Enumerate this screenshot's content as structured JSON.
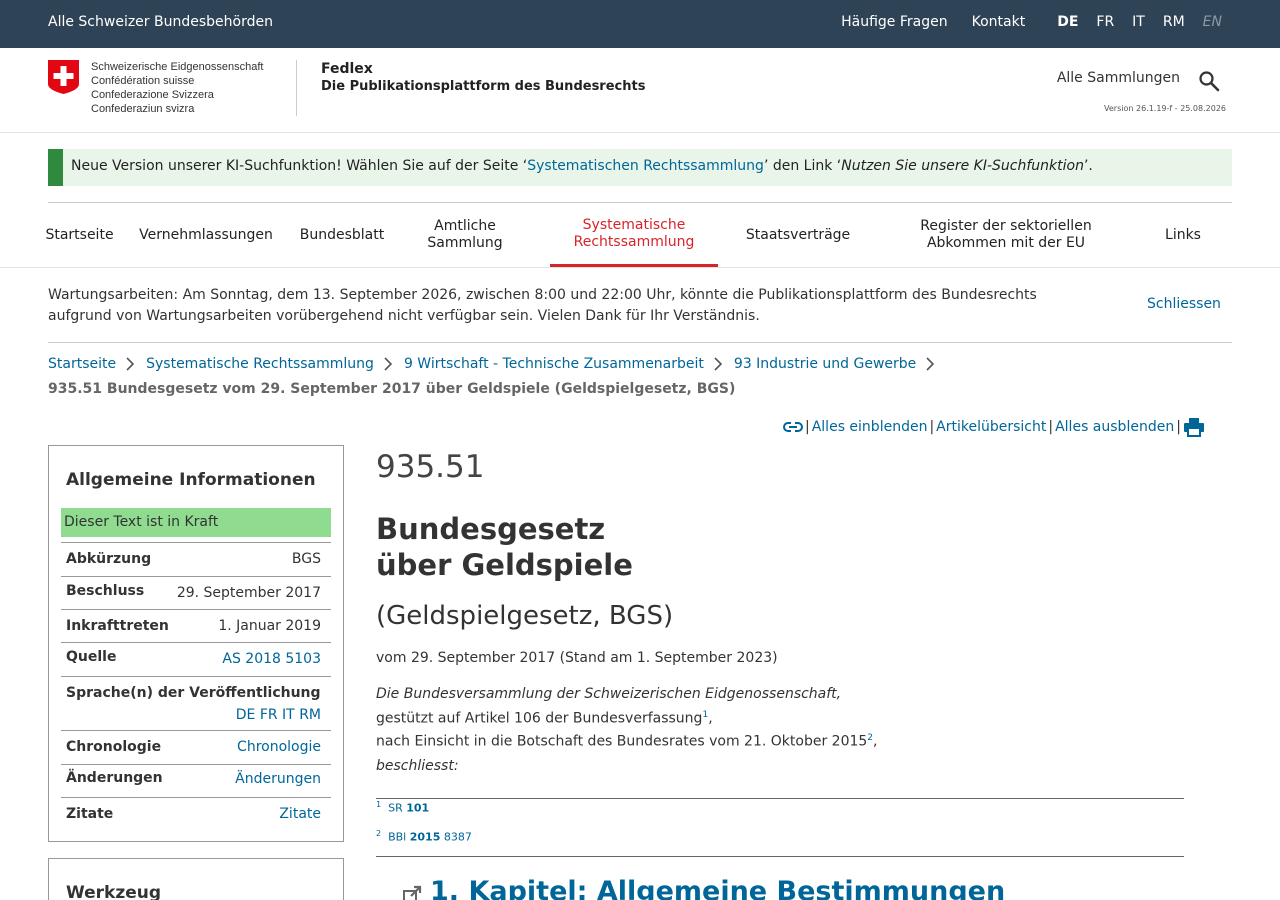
{
  "topbar": {
    "left": "Alle Schweizer Bundesbehörden",
    "faq": "Häufige Fragen",
    "contact": "Kontakt",
    "langs": [
      "DE",
      "FR",
      "IT",
      "RM",
      "EN"
    ]
  },
  "header": {
    "conf": [
      "Schweizerische Eidgenossenschaft",
      "Confédération suisse",
      "Confederazione Svizzera",
      "Confederaziun svizra"
    ],
    "title": "Fedlex",
    "subtitle": "Die Publikationsplattform des Bundesrechts",
    "collections": "Alle Sammlungen",
    "version": "Version 26.1.19-f - 25.08.2026"
  },
  "banner": {
    "pre": "Neue Version unserer KI-Suchfunktion! Wählen Sie auf der Seite ‘",
    "link": "Systematischen Rechtssammlung",
    "mid": "’ den Link ‘",
    "italic": "Nutzen Sie unsere KI-Suchfunktion",
    "post": "’."
  },
  "nav": [
    {
      "label": "Startseite"
    },
    {
      "label": "Vernehmlassungen"
    },
    {
      "label": "Bundesblatt"
    },
    {
      "label": "Amtliche Sammlung"
    },
    {
      "label": "Systematische Rechtssammlung"
    },
    {
      "label": "Staatsverträge"
    },
    {
      "label": "Register der sektoriellen Abkommen mit der EU"
    },
    {
      "label": "Links"
    }
  ],
  "maintenance": {
    "text": "Wartungsarbeiten: Am Sonntag, dem 13. September 2026, zwischen 8:00 und 22:00 Uhr, könnte die Publikationsplattform des Bundesrechts aufgrund von Wartungsarbeiten vorübergehend nicht verfügbar sein. Vielen Dank für Ihr Verständnis.",
    "close": "Schliessen"
  },
  "breadcrumb": {
    "items": [
      "Startseite",
      "Systematische Rechtssammlung",
      "9 Wirtschaft - Technische Zusammenarbeit",
      "93 Industrie und Gewerbe"
    ],
    "current": "935.51 Bundesgesetz vom 29. September 2017 über Geldspiele (Geldspielgesetz, BGS)"
  },
  "toolbar": {
    "show_all": "Alles einblenden",
    "overview": "Artikelübersicht",
    "hide_all": "Alles ausblenden"
  },
  "sidebar": {
    "title": "Allgemeine Informationen",
    "status": "Dieser Text ist in Kraft",
    "rows": [
      {
        "k": "Abkürzung",
        "v": "BGS"
      },
      {
        "k": "Beschluss",
        "v": "29. September 2017"
      },
      {
        "k": "Inkrafttreten",
        "v": "1. Januar 2019"
      },
      {
        "k": "Quelle",
        "v": "AS 2018 5103"
      },
      {
        "k": "Sprache(n) der Veröffentlichung",
        "v": "DE FR IT RM"
      },
      {
        "k": "Chronologie",
        "v": "Chronologie"
      },
      {
        "k": "Änderungen",
        "v": "Änderungen"
      },
      {
        "k": "Zitate",
        "v": "Zitate"
      }
    ],
    "tools_title": "Werkzeug"
  },
  "main": {
    "number": "935.51",
    "title_line1": "Bundesgesetz",
    "title_line2": "über Geldspiele",
    "short": "(Geldspielgesetz, BGS)",
    "date": "vom 29. September 2017 (Stand am 1. September 2023)",
    "ingress1": "Die Bundesversammlung der Schweizerischen Eidgenossenschaft,",
    "ingress2": "gestützt auf Artikel 106 der Bundesverfassung",
    "ingress2_sup": "1",
    "ingress3": "nach Einsicht in die Botschaft des Bundesrates vom 21. Oktober 2015",
    "ingress3_sup": "2",
    "ingress4": "beschliesst:",
    "fn1": {
      "sup": "1",
      "a": "SR",
      "b": "101"
    },
    "fn2": {
      "sup": "2",
      "a": "BBl",
      "b": "2015",
      "c": "8387"
    },
    "chapter": "1. Kapitel: Allgemeine Bestimmungen"
  },
  "colors": {
    "topbar": "#2f4356",
    "link": "#006699",
    "active": "#d8232a",
    "inkraft": "#8fdb8f"
  }
}
